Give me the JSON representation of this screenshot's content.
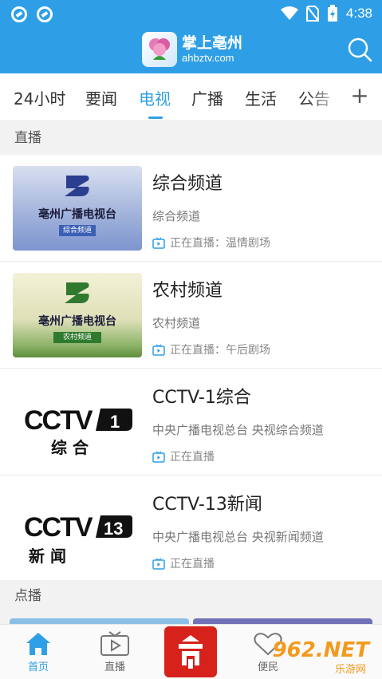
{
  "status_bar": {
    "time": "4:38"
  },
  "header": {
    "logo_title": "掌上亳州",
    "logo_domain": "ahbztv.com"
  },
  "tabs": [
    {
      "label": "24小时"
    },
    {
      "label": "要闻"
    },
    {
      "label": "电视",
      "active": true
    },
    {
      "label": "广播"
    },
    {
      "label": "生活"
    },
    {
      "label": "公告"
    }
  ],
  "tab_add": "+",
  "sections": {
    "live": "直播",
    "vod": "点播"
  },
  "channels": [
    {
      "title": "综合频道",
      "desc": "综合频道",
      "live": "正在直播：温情剧场",
      "thumb_name": "亳州广播电视台",
      "thumb_sub": "综合频道"
    },
    {
      "title": "农村频道",
      "desc": "农村频道",
      "live": "正在直播：午后剧场",
      "thumb_name": "亳州广播电视台",
      "thumb_sub": "农村频道"
    },
    {
      "title": "CCTV-1综合",
      "desc": "中央广播电视总台 央视综合频道",
      "live": "正在直播",
      "thumb_num": "1",
      "thumb_cn": "综 合"
    },
    {
      "title": "CCTV-13新闻",
      "desc": "中央广播电视总台 央视新闻频道",
      "live": "正在直播",
      "thumb_num": "13",
      "thumb_cn": "新 闻"
    }
  ],
  "bottom_nav": [
    {
      "label": "首页",
      "active": true
    },
    {
      "label": "直播"
    },
    {
      "label": "便民"
    }
  ],
  "watermark": {
    "big": "962.NET",
    "small": "乐游网"
  },
  "colors": {
    "brand": "#2e9fe6",
    "center": "#d6221b"
  }
}
